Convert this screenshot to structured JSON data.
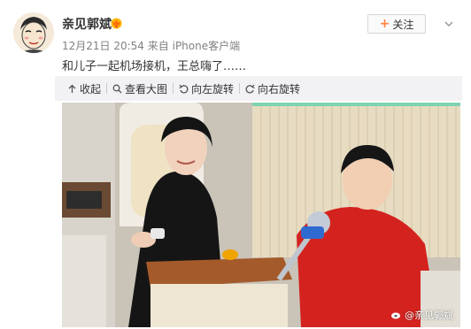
{
  "post": {
    "username": "亲见郭斌",
    "timestamp": "12月21日 20:54",
    "source_prefix": "来自",
    "source": "iPhone客户端",
    "text": "和儿子一起机场接机，王总嗨了……"
  },
  "actions": {
    "follow_label": "关注"
  },
  "toolbar": {
    "collapse_label": "收起",
    "view_large_label": "查看大图",
    "rotate_left_label": "向左旋转",
    "rotate_right_label": "向右旋转"
  },
  "photo": {
    "watermark": "@亲见郭斌"
  },
  "colors": {
    "follow_plus": "#ff8140",
    "toolbar_bg": "#f2f2f5",
    "meta_text": "#808080"
  },
  "icons": {
    "vip": "vip-crown-icon",
    "collapse": "arrow-up-icon",
    "view_large": "magnifier-icon",
    "rotate_left": "rotate-left-icon",
    "rotate_right": "rotate-right-icon",
    "menu": "chevron-down-icon"
  }
}
